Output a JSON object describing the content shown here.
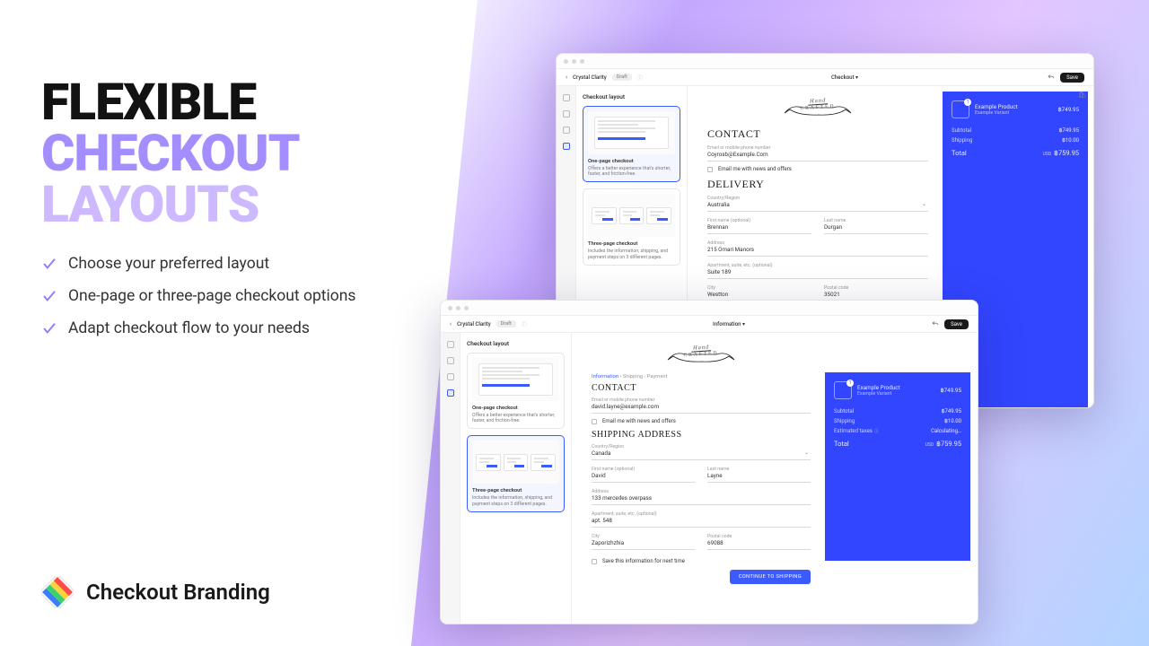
{
  "headline": {
    "line1": "Flexible",
    "line2": "Checkout",
    "line3": "Layouts"
  },
  "features": [
    "Choose your preferred layout",
    "One-page or three-page checkout options",
    "Adapt checkout flow to your needs"
  ],
  "brand_name": "Checkout Branding",
  "shared": {
    "store_name": "Crystal Clarity",
    "draft_badge": "Draft",
    "save_btn": "Save",
    "panel_title": "Checkout layout",
    "opt_one": {
      "title": "One-page checkout",
      "desc": "Offers a better experience that's shorter, faster, and friction-free."
    },
    "opt_three": {
      "title": "Three-page checkout",
      "desc": "Includes the information, shipping, and payment steps on 3 different pages."
    },
    "product": {
      "name": "Example Product",
      "variant": "Example Variant",
      "price": "฿749.95"
    },
    "summary": {
      "subtotal": {
        "label": "Subtotal",
        "value": "฿749.95"
      },
      "shipping": {
        "label": "Shipping",
        "value": "฿10.00"
      },
      "tax": {
        "label": "Estimated taxes",
        "value": "Calculating…"
      },
      "total": {
        "label": "Total",
        "currency": "USD",
        "value": "฿759.95"
      }
    },
    "logo": {
      "hand": "Hand",
      "crafted": "CRAFTED"
    }
  },
  "window_back": {
    "breadcrumb": "Checkout ▾",
    "contact_h": "CONTACT",
    "email_label": "Email or mobile phone number",
    "email_value": "Coyrosb@Example.Com",
    "optin": "Email me with news and offers",
    "delivery_h": "DELIVERY",
    "country_label": "Country/Region",
    "country_value": "Australia",
    "first_label": "First name (optional)",
    "first_value": "Brennan",
    "last_label": "Last name",
    "last_value": "Durgan",
    "addr_label": "Address",
    "addr_value": "215 Omari Manors",
    "apt_label": "Apartment, suite, etc. (optional)",
    "apt_value": "Suite 189",
    "city_label": "City",
    "city_value": "Westton",
    "zip_label": "Postal code",
    "zip_value": "35021"
  },
  "window_front": {
    "breadcrumb": "Information ▾",
    "crumbs": {
      "info": "Information",
      "ship": "Shipping",
      "pay": "Payment"
    },
    "contact_h": "CONTACT",
    "email_label": "Email or mobile phone number",
    "email_value": "david.layne@example.com",
    "optin": "Email me with news and offers",
    "ship_h": "SHIPPING ADDRESS",
    "country_label": "Country/Region",
    "country_value": "Canada",
    "first_label": "First name (optional)",
    "first_value": "David",
    "last_label": "Last name",
    "last_value": "Layne",
    "addr_label": "Address",
    "addr_value": "133 mercedes overpass",
    "apt_label": "Apartment, suite, etc. (optional)",
    "apt_value": "apt. 548",
    "city_label": "City",
    "city_value": "Zaporizhzhia",
    "zip_label": "Postal code",
    "zip_value": "69088",
    "save_info": "Save this information for next time",
    "continue": "CONTINUE TO SHIPPING"
  }
}
